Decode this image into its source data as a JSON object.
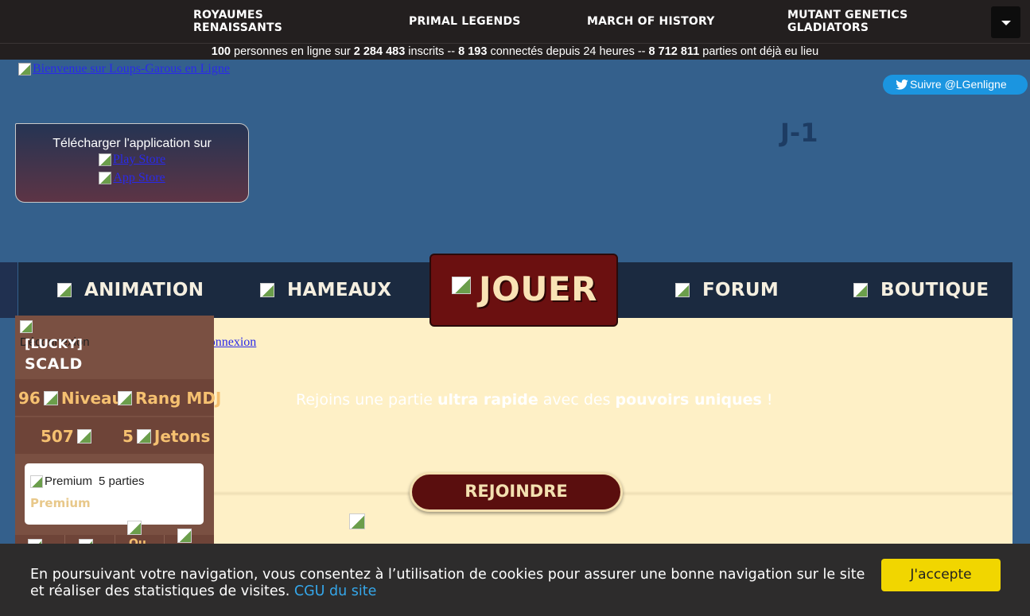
{
  "topnav": {
    "games": [
      {
        "line1": "ROYAUMES",
        "line2": "RENAISSANTS"
      },
      {
        "line1": "PRIMAL LEGENDS",
        "line2": ""
      },
      {
        "line1": "MARCH OF HISTORY",
        "line2": ""
      },
      {
        "line1": "MUTANT GENETICS",
        "line2": "GLADIATORS"
      }
    ],
    "dropdown_icon": "caret-down-icon"
  },
  "stats": {
    "online": "100",
    "online_text": " personnes en ligne sur ",
    "registered": "2 284 483",
    "registered_text": " inscrits -- ",
    "connected": "8 193",
    "connected_text": " connectés depuis 24 heures -- ",
    "games": "8 712 811",
    "games_text": " parties ont déjà eu lieu"
  },
  "header": {
    "welcome_alt": "Bienvenue sur Loups-Garous en Ligne",
    "twitter": "Suivre @LGenligne",
    "day": "J-1"
  },
  "download": {
    "title": "Télécharger l'application sur",
    "play_store": "Play Store",
    "app_store": "App Store"
  },
  "menu": {
    "animation": "ANIMATION",
    "hameaux": "HAMEAUX",
    "jouer": "JOUER",
    "forum": "FORUM",
    "boutique": "BOUTIQUE"
  },
  "content": {
    "promo_1": "Rejoins une partie ",
    "promo_2": "ultra rapide",
    "promo_3": " avec des ",
    "promo_4": "pouvoirs uniques",
    "promo_5": " !",
    "join_button": "REJOINDRE",
    "logout_link": "Déconnexion"
  },
  "profile": {
    "overlay_text": "Déconnexion",
    "tag": "[LUCKY]",
    "name": "SCALD",
    "level_value": "96",
    "level_alt": "Niveau",
    "rank_alt": "Rang MDJ",
    "points_value": "507",
    "tokens_value": "5",
    "tokens_alt": "Jetons",
    "premium_alt": "Premium",
    "premium_games": "5 parties",
    "premium_label": "Premium",
    "partial_text": "Ou"
  },
  "cookie": {
    "message": "En poursuivant votre navigation, vous consentez à l’utilisation de cookies pour assurer une bonne navigation sur le site et réaliser des statistiques de visites. ",
    "link": "CGU du site",
    "accept": "J'accepte"
  },
  "colors": {
    "background": "#34608c",
    "topbar": "#231f1f",
    "menubar": "#1b2a40",
    "jouer": "#6b1010",
    "content": "#fef0c6",
    "accept": "#f1d600",
    "link": "#35a7ea"
  }
}
